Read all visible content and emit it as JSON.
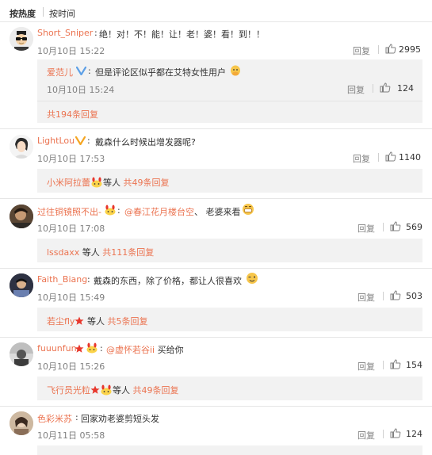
{
  "sort": {
    "hot": "按热度",
    "time": "按时间"
  },
  "colors": {
    "name": "#eb7350",
    "meta": "#808080",
    "text": "#333333",
    "reply_bg": "#f2f2f2",
    "verified": "#f5a623",
    "star": "#e8372c"
  },
  "actions": {
    "reply": "回复"
  },
  "comments": [
    {
      "user": "Short_Sniper",
      "text": "绝！对！不！能！让！老！婆！看！到！！",
      "date": "10月10日 15:22",
      "likes": "2995",
      "sub": {
        "user": "爱范儿",
        "text": "但是评论区似乎都在艾特女性用户",
        "emoji": "blush-emoji",
        "date": "10月10日 15:24",
        "likes": "124"
      },
      "more": "共194条回复"
    },
    {
      "user": "LightLou",
      "text": "戴森什么时候出增发器呢?",
      "date": "10月10日 17:53",
      "likes": "1140",
      "more_name": "小米阿拉蕾",
      "more_emoji": "rabbit-emoji",
      "more_plain": "等人",
      "more": "共49条回复"
    },
    {
      "user": "过往铜镜照不出-",
      "mention": "@春江花月楼台空",
      "text": "、 老婆来看",
      "emoji": "grin-emoji",
      "date": "10月10日 17:08",
      "likes": "569",
      "more_name": "lssdaxx",
      "more_plain": "等人",
      "more": "共111条回复"
    },
    {
      "user": "Faith_Biang",
      "text": "戴森的东西，除了价格，都让人很喜欢",
      "emoji": "wink-emoji",
      "date": "10月10日 15:49",
      "likes": "503",
      "more_name": "若尘fly",
      "more_plain": "等人",
      "more": "共5条回复"
    },
    {
      "user": "fuuunfun",
      "mention": "@虚怀若谷ii",
      "text": "买给你",
      "date": "10月10日 15:26",
      "likes": "154",
      "more_name": "飞行员光粒",
      "more_emoji": "rabbit-emoji",
      "more_plain": "等人",
      "more": "共49条回复"
    },
    {
      "user": "色彩米苏",
      "text": "回家劝老婆剪短头发",
      "date": "10月11日 05:58",
      "likes": "124"
    }
  ]
}
